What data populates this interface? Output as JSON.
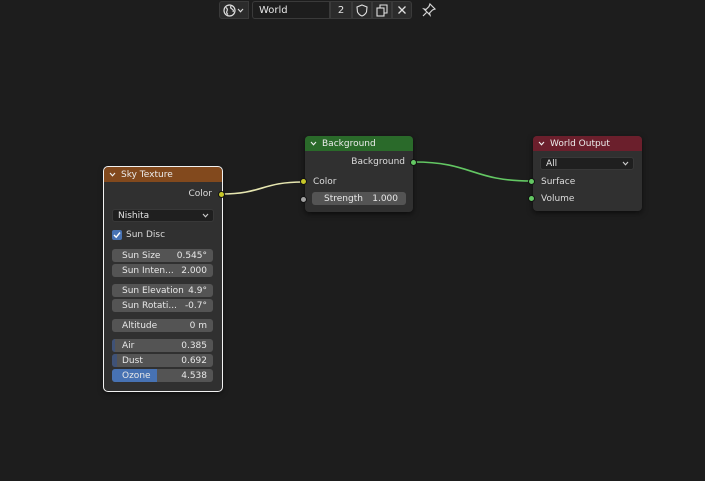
{
  "header": {
    "world_name": "World",
    "users_count": "2"
  },
  "sky_texture": {
    "title": "Sky Texture",
    "header_color": "#82491d",
    "output_color_label": "Color",
    "sky_type": "Nishita",
    "sun_disc_label": "Sun Disc",
    "sun_disc_checked": true,
    "fields": {
      "sun_size": {
        "label": "Sun Size",
        "value": "0.545°"
      },
      "sun_intensity": {
        "label": "Sun Inten...",
        "value": "2.000"
      },
      "sun_elevation": {
        "label": "Sun Elevation",
        "value": "4.9°"
      },
      "sun_rotation": {
        "label": "Sun Rotati...",
        "value": "-0.7°"
      },
      "altitude": {
        "label": "Altitude",
        "value": "0 m"
      },
      "air": {
        "label": "Air",
        "value": "0.385"
      },
      "dust": {
        "label": "Dust",
        "value": "0.692"
      },
      "ozone": {
        "label": "Ozone",
        "value": "4.538"
      }
    }
  },
  "background": {
    "title": "Background",
    "header_color": "#2a6a2a",
    "output_label": "Background",
    "color_input_label": "Color",
    "strength": {
      "label": "Strength",
      "value": "1.000"
    }
  },
  "world_output": {
    "title": "World Output",
    "header_color": "#6b1f2c",
    "target": "All",
    "surface_label": "Surface",
    "volume_label": "Volume"
  }
}
